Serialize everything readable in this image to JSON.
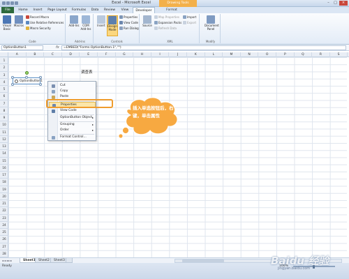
{
  "window": {
    "title": "Excel - Microsoft Excel",
    "context_tab_group": "Drawing Tools"
  },
  "ribbon_tabs": [
    "File",
    "Home",
    "Insert",
    "Page Layout",
    "Formulas",
    "Data",
    "Review",
    "View",
    "Developer",
    "Format"
  ],
  "active_tab": "Developer",
  "ribbon": {
    "code": {
      "label": "Code",
      "visual_basic": "Visual Basic",
      "macros": "Macros",
      "record_macro": "Record Macro",
      "relative_refs": "Use Relative References",
      "macro_security": "Macro Security"
    },
    "addins": {
      "label": "Add-Ins",
      "add_ins": "Add-Ins",
      "com_add_ins": "COM Add-Ins"
    },
    "controls": {
      "label": "Controls",
      "insert": "Insert",
      "design_mode": "Design Mode",
      "properties": "Properties",
      "view_code": "View Code",
      "run_dialog": "Run Dialog"
    },
    "xml": {
      "label": "XML",
      "source": "Source",
      "map_properties": "Map Properties",
      "expansion_packs": "Expansion Packs",
      "refresh_data": "Refresh Data",
      "import": "Import",
      "export": "Export"
    },
    "modify": {
      "label": "Modify",
      "document_panel": "Document Panel"
    }
  },
  "formula_bar": {
    "name_box": "OptionButton1",
    "fx": "fx",
    "formula": "=EMBED(\"Forms.OptionButton.1\",\"\")"
  },
  "columns": [
    "A",
    "B",
    "C",
    "D",
    "E",
    "F",
    "G",
    "H",
    "I",
    "J",
    "K",
    "L",
    "M",
    "N",
    "O",
    "P",
    "Q",
    "R",
    "S"
  ],
  "rows": [
    "1",
    "2",
    "3",
    "4",
    "5",
    "6",
    "7",
    "8",
    "9",
    "10",
    "11",
    "12",
    "13",
    "14",
    "15",
    "16",
    "17",
    "18",
    "19",
    "20",
    "21",
    "22",
    "23",
    "24",
    "25",
    "26",
    "27",
    "28"
  ],
  "sheet": {
    "title_cell": "调查表",
    "option_button_label": "OptionButton1"
  },
  "context_menu": {
    "items": [
      {
        "label": "Cut",
        "icon": "scissors-icon",
        "submenu": false
      },
      {
        "label": "Copy",
        "icon": "copy-icon",
        "submenu": false
      },
      {
        "label": "Paste",
        "icon": "paste-icon",
        "submenu": false
      },
      {
        "label": "Properties",
        "icon": "properties-icon",
        "submenu": false,
        "highlighted": true
      },
      {
        "label": "View Code",
        "icon": "view-code-icon",
        "submenu": false
      },
      {
        "label": "OptionButton Object",
        "icon": "",
        "submenu": true
      },
      {
        "label": "Grouping",
        "icon": "",
        "submenu": true
      },
      {
        "label": "Order",
        "icon": "",
        "submenu": true
      },
      {
        "label": "Format Control...",
        "icon": "format-control-icon",
        "submenu": false
      }
    ]
  },
  "callout": {
    "line1": "插入单选按钮后，右",
    "line2": "键，单击属性"
  },
  "sheet_tabs": [
    "Sheet1",
    "Sheet2",
    "Sheet3"
  ],
  "active_sheet": "Sheet1",
  "status": {
    "ready": "Ready",
    "zoom": "100%"
  },
  "watermark": {
    "text": "Baidu 经验",
    "sub": "jingyan.baidu.com"
  },
  "colors": {
    "accent_orange": "#ef9c2d",
    "context_tab": "#f3b04a",
    "file_tab": "#2e6a3d",
    "bubble_fill": "#f7a941"
  }
}
